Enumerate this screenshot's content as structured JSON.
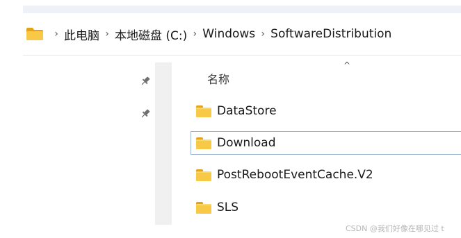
{
  "breadcrumb": {
    "root_icon": "folder-icon",
    "separator": "›",
    "items": [
      {
        "label": "此电脑"
      },
      {
        "label": "本地磁盘 (C:)"
      },
      {
        "label": "Windows"
      },
      {
        "label": "SoftwareDistribution"
      }
    ]
  },
  "quick_access": {
    "pins": [
      "pin-icon",
      "pin-icon"
    ]
  },
  "file_list": {
    "column_header": "名称",
    "sort_indicator": "^",
    "items": [
      {
        "name": "DataStore",
        "icon": "folder-icon",
        "selected": false
      },
      {
        "name": "Download",
        "icon": "folder-icon",
        "selected": true
      },
      {
        "name": "PostRebootEventCache.V2",
        "icon": "folder-icon",
        "selected": false
      },
      {
        "name": "SLS",
        "icon": "folder-icon",
        "selected": false
      }
    ]
  },
  "watermark": "CSDN @我们好像在哪见过 t",
  "colors": {
    "folder_body": "#f8c847",
    "folder_tab": "#e3a21a",
    "selection_border": "#99b4d1"
  }
}
